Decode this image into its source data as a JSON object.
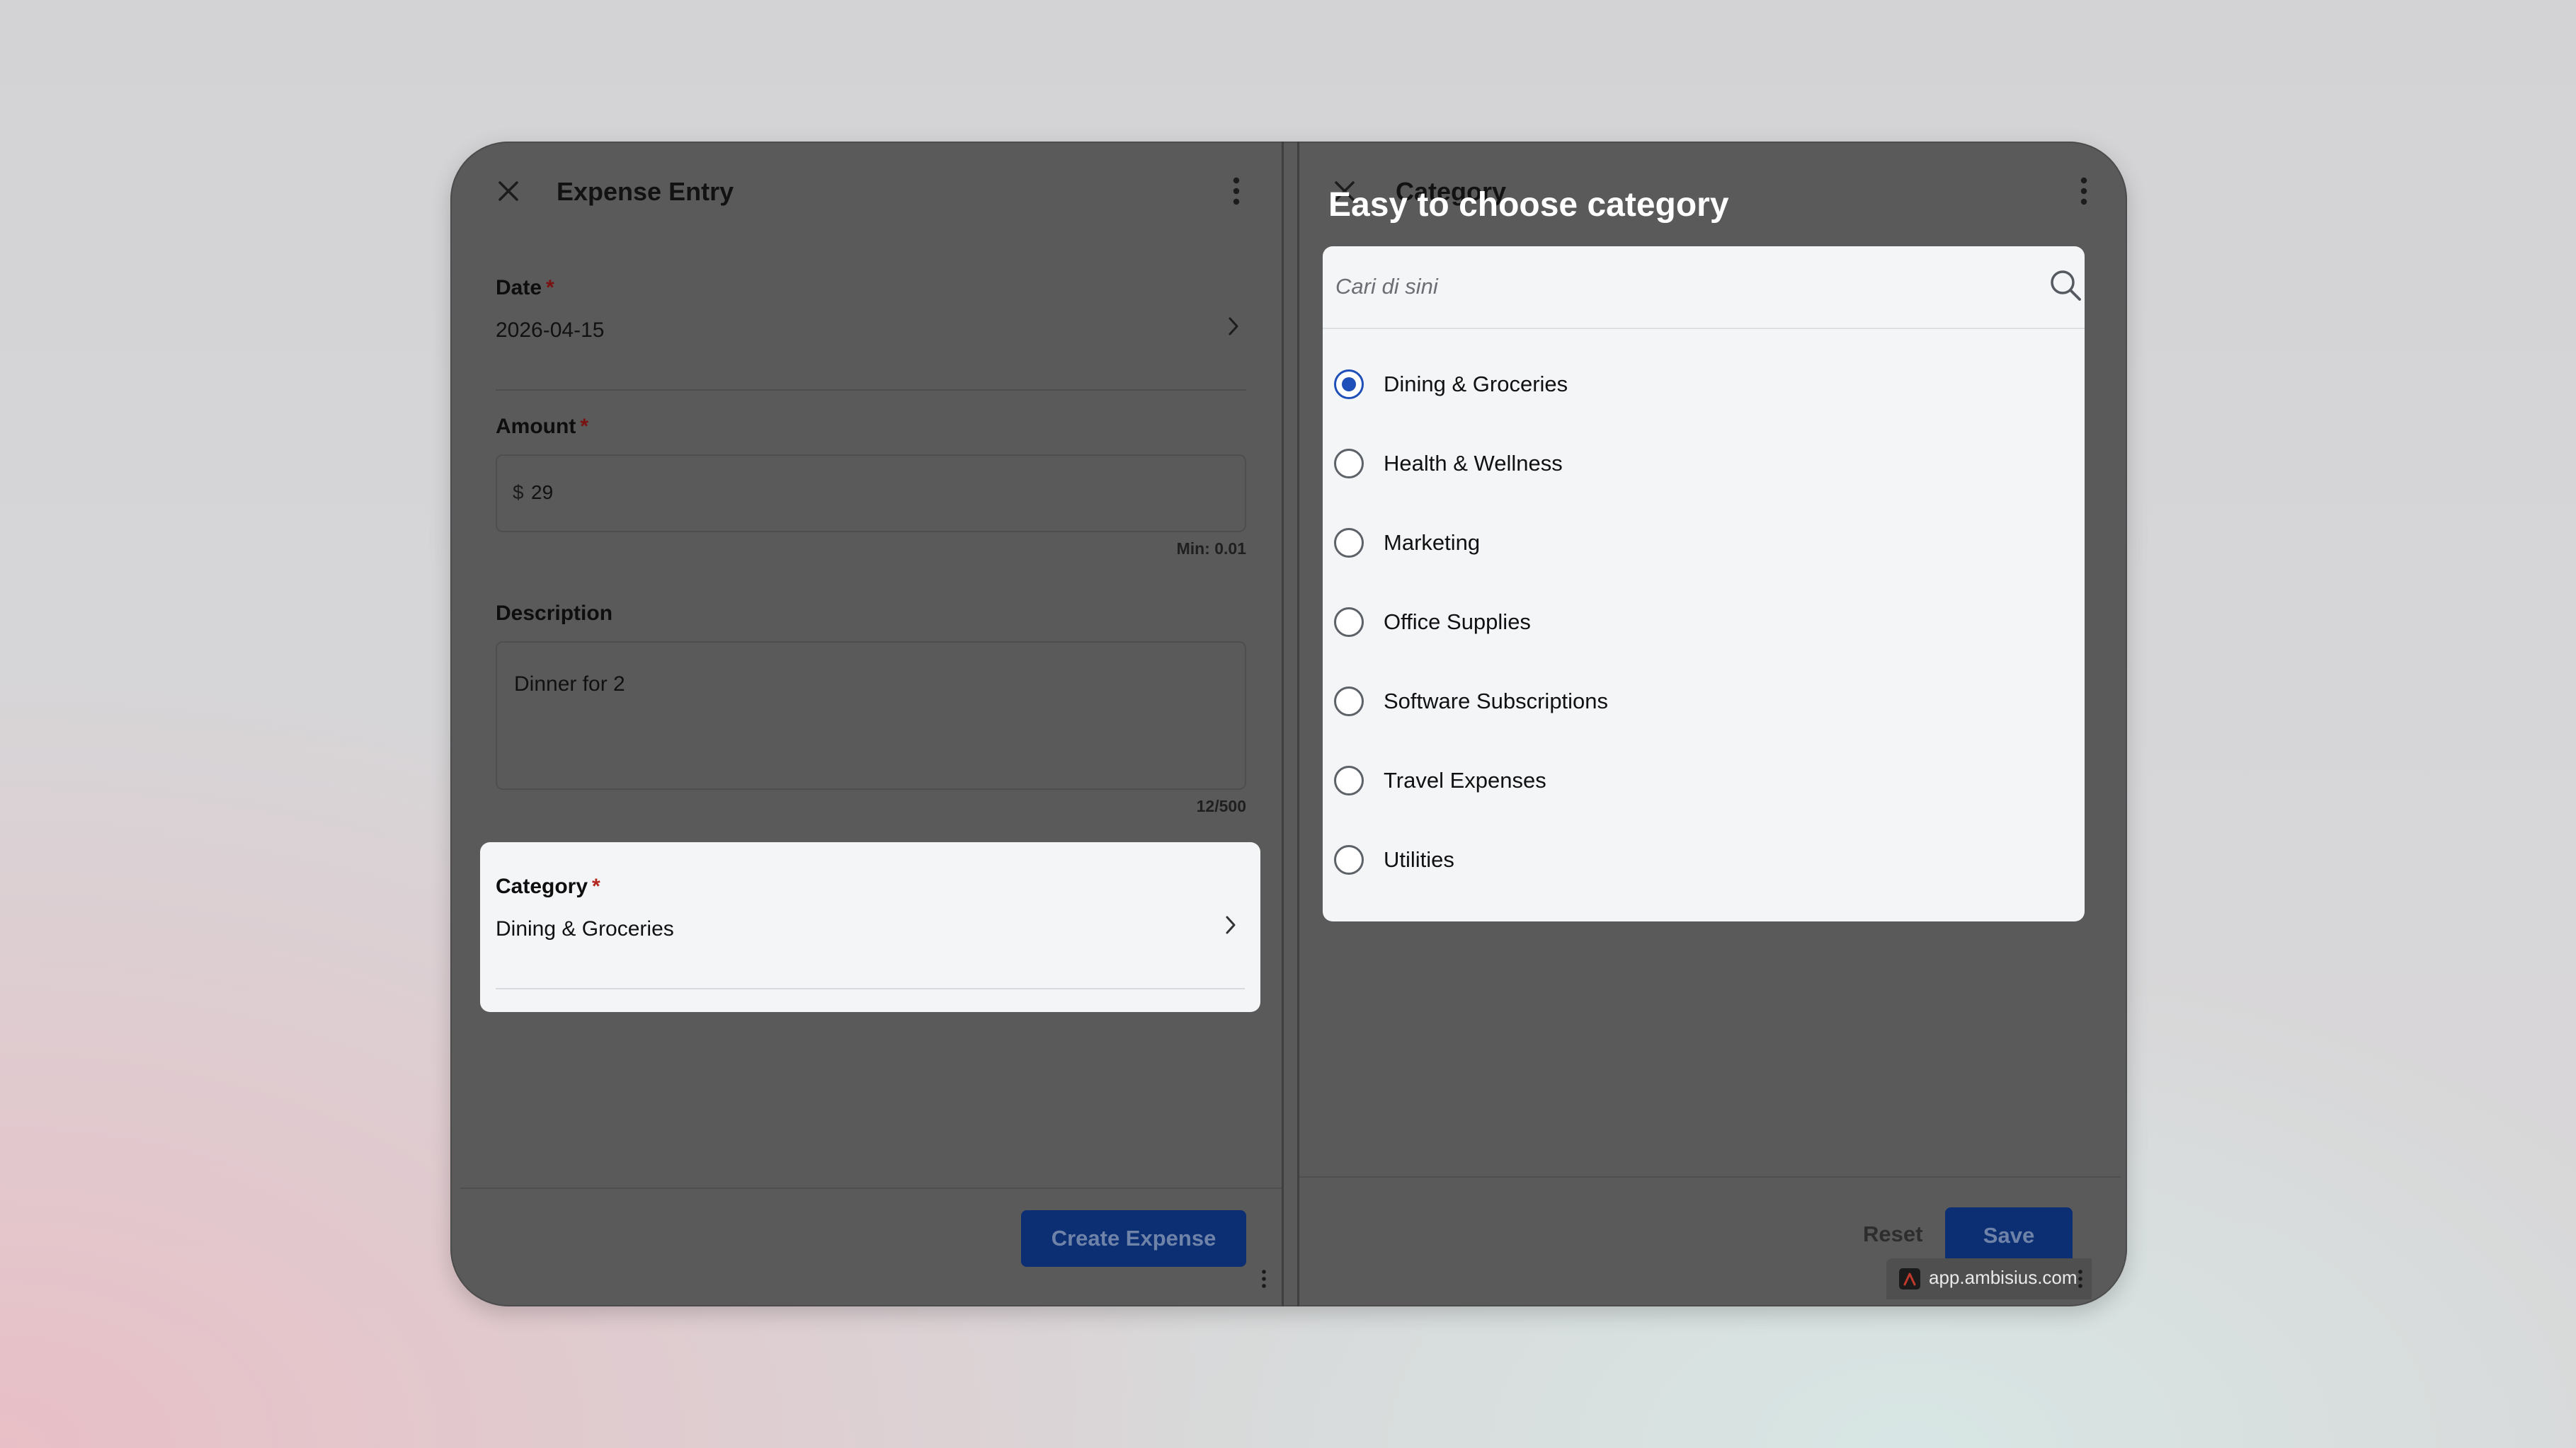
{
  "left_pane": {
    "title": "Expense Entry",
    "fields": {
      "date": {
        "label": "Date",
        "required_mark": "*",
        "value": "2026-04-15"
      },
      "amount": {
        "label": "Amount",
        "required_mark": "*",
        "currency": "$",
        "value": "29",
        "hint": "Min: 0.01"
      },
      "description": {
        "label": "Description",
        "value": "Dinner for 2",
        "counter": "12/500"
      },
      "category": {
        "label": "Category",
        "required_mark": "*",
        "value": "Dining & Groceries"
      }
    },
    "create_button": "Create Expense"
  },
  "right_pane": {
    "title": "Category",
    "reset_button": "Reset",
    "save_button": "Save"
  },
  "overlay": {
    "heading": "Easy to choose category",
    "search_placeholder": "Cari di sini",
    "selected": "Dining & Groceries",
    "options": [
      "Dining & Groceries",
      "Health & Wellness",
      "Marketing",
      "Office Supplies",
      "Software Subscriptions",
      "Travel Expenses",
      "Utilities"
    ]
  },
  "browser_chip": {
    "url": "app.ambisius.com"
  },
  "colors": {
    "accent": "#1f4fb8",
    "primary_button": "#0c2f73",
    "scrim": "#5a5a5a"
  }
}
